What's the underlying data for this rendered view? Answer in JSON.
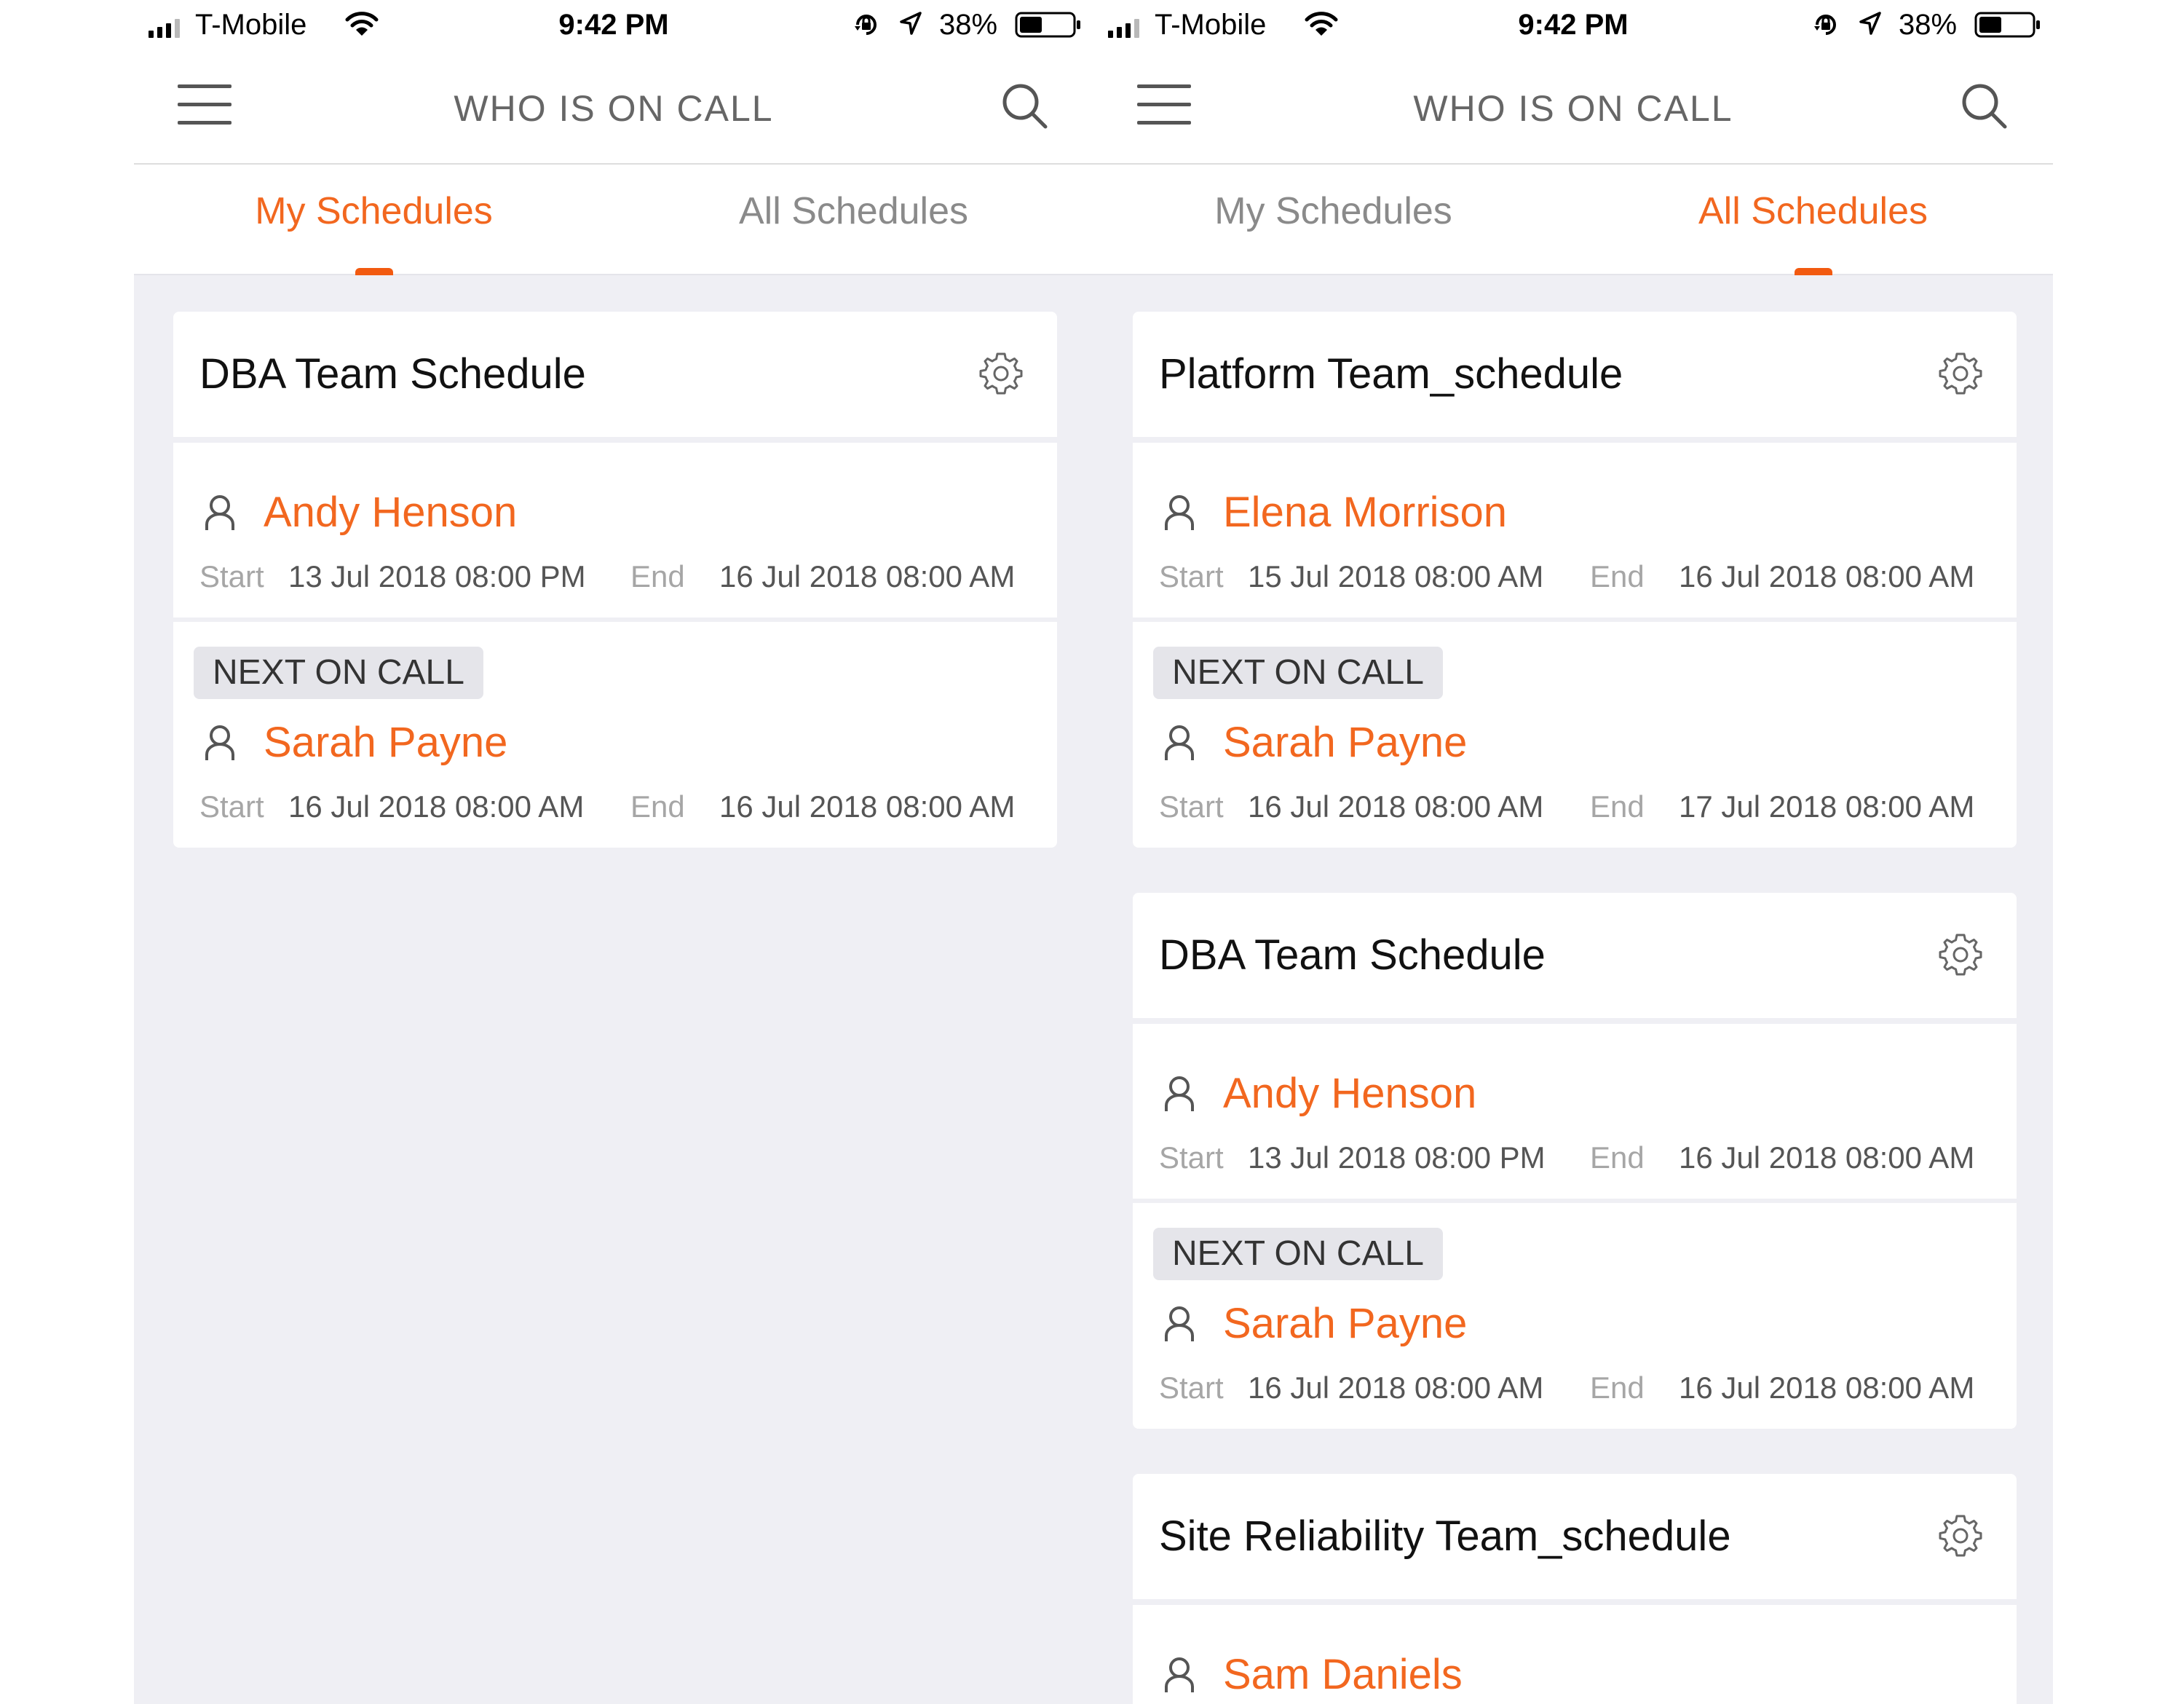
{
  "left": {
    "status": {
      "carrier": "T-Mobile",
      "time": "9:42 PM",
      "battery": "38%"
    },
    "header": {
      "title": "WHO IS ON CALL"
    },
    "tabs": {
      "my": "My Schedules",
      "all": "All Schedules",
      "active": "my"
    },
    "schedules": [
      {
        "name": "DBA Team Schedule",
        "current": {
          "person": "Andy Henson",
          "start_label": "Start",
          "start": "13 Jul 2018 08:00 PM",
          "end_label": "End",
          "end": "16 Jul 2018 08:00 AM"
        },
        "next_label": "NEXT ON CALL",
        "next": {
          "person": "Sarah Payne",
          "start_label": "Start",
          "start": "16 Jul 2018 08:00 AM",
          "end_label": "End",
          "end": "16 Jul 2018 08:00 AM"
        }
      }
    ]
  },
  "right": {
    "status": {
      "carrier": "T-Mobile",
      "time": "9:42 PM",
      "battery": "38%"
    },
    "header": {
      "title": "WHO IS ON CALL"
    },
    "tabs": {
      "my": "My Schedules",
      "all": "All Schedules",
      "active": "all"
    },
    "schedules": [
      {
        "name": "Platform Team_schedule",
        "current": {
          "person": "Elena Morrison",
          "start_label": "Start",
          "start": "15 Jul 2018 08:00 AM",
          "end_label": "End",
          "end": "16 Jul 2018 08:00 AM"
        },
        "next_label": "NEXT ON CALL",
        "next": {
          "person": "Sarah Payne",
          "start_label": "Start",
          "start": "16 Jul 2018 08:00 AM",
          "end_label": "End",
          "end": "17 Jul 2018 08:00 AM"
        }
      },
      {
        "name": "DBA Team Schedule",
        "current": {
          "person": "Andy Henson",
          "start_label": "Start",
          "start": "13 Jul 2018 08:00 PM",
          "end_label": "End",
          "end": "16 Jul 2018 08:00 AM"
        },
        "next_label": "NEXT ON CALL",
        "next": {
          "person": "Sarah Payne",
          "start_label": "Start",
          "start": "16 Jul 2018 08:00 AM",
          "end_label": "End",
          "end": "16 Jul 2018 08:00 AM"
        }
      },
      {
        "name": "Site Reliability Team_schedule",
        "current": {
          "person": "Sam Daniels"
        }
      }
    ]
  },
  "colors": {
    "accent": "#f2671f",
    "background": "#efeff4",
    "badge": "#e5e5ea"
  }
}
